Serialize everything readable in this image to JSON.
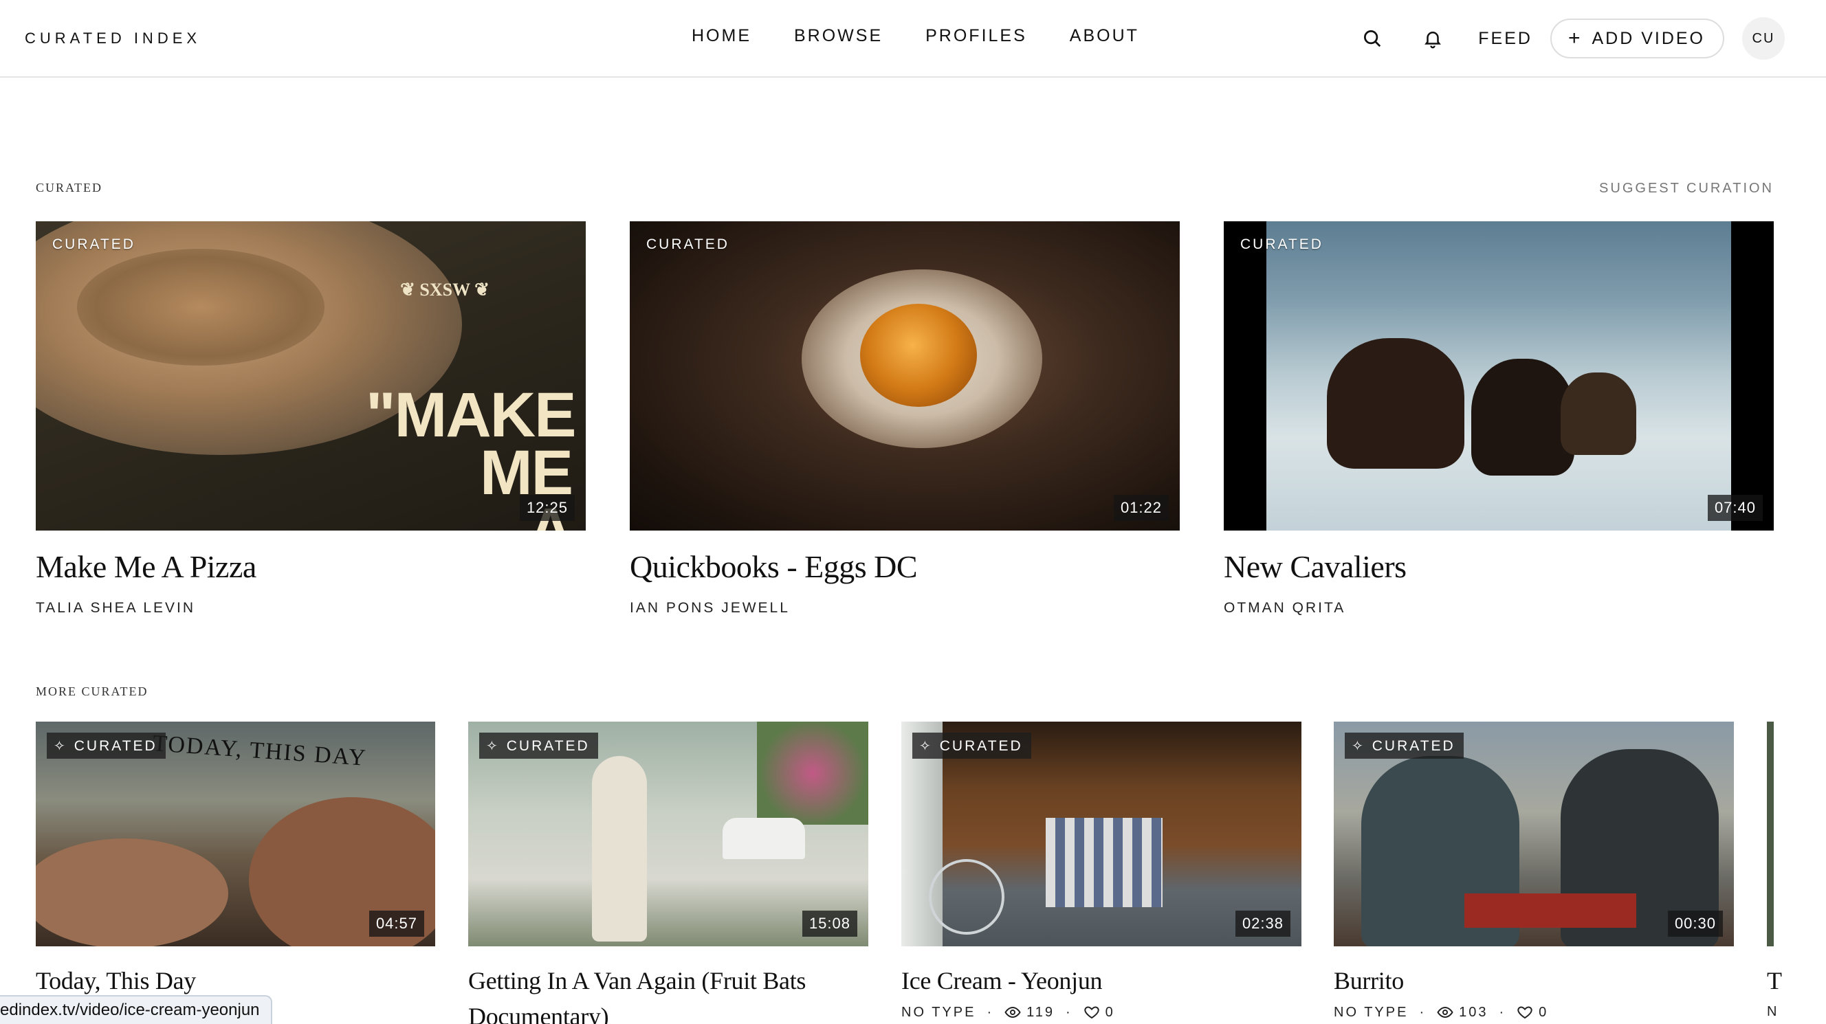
{
  "header": {
    "brand": "CURATED INDEX",
    "nav": [
      "HOME",
      "BROWSE",
      "PROFILES",
      "ABOUT"
    ],
    "feed_label": "FEED",
    "add_video_label": "ADD VIDEO",
    "avatar_initials": "CU"
  },
  "curated": {
    "label": "CURATED",
    "suggest_label": "SUGGEST CURATION",
    "items": [
      {
        "badge": "CURATED",
        "duration": "12:25",
        "title": "Make Me A Pizza",
        "author": "TALIA SHEA LEVIN"
      },
      {
        "badge": "CURATED",
        "duration": "01:22",
        "title": "Quickbooks - Eggs DC",
        "author": "IAN PONS JEWELL"
      },
      {
        "badge": "CURATED",
        "duration": "07:40",
        "title": "New Cavaliers",
        "author": "OTMAN QRITA"
      }
    ]
  },
  "more": {
    "label": "MORE CURATED",
    "items": [
      {
        "badge": "CURATED",
        "duration": "04:57",
        "title": "Today, This Day"
      },
      {
        "badge": "CURATED",
        "duration": "15:08",
        "title": "Getting In A Van Again (Fruit Bats Documentary)"
      },
      {
        "badge": "CURATED",
        "duration": "02:38",
        "title": "Ice Cream - Yeonjun",
        "type": "NO TYPE",
        "views": "119",
        "likes": "0"
      },
      {
        "badge": "CURATED",
        "duration": "00:30",
        "title": "Burrito",
        "type": "NO TYPE",
        "views": "103",
        "likes": "0"
      }
    ],
    "partial_title": "T",
    "partial_meta": "N"
  },
  "status_url": "edindex.tv/video/ice-cream-yeonjun"
}
